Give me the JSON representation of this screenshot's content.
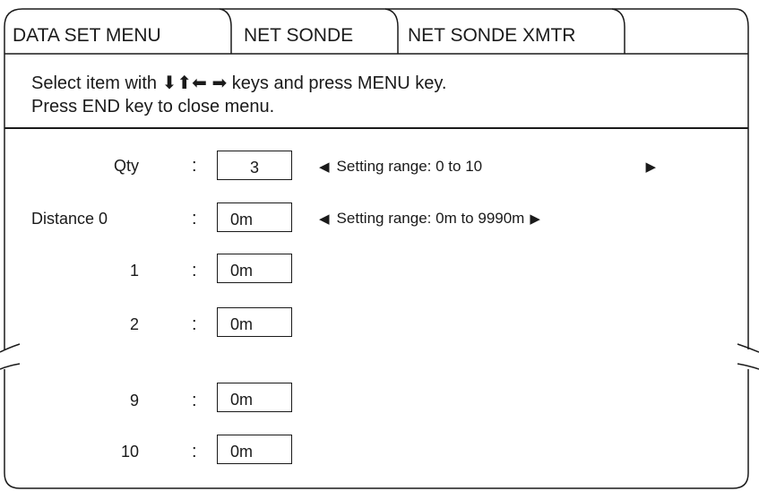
{
  "tabs": [
    "DATA SET MENU",
    "NET SONDE",
    "NET SONDE XMTR"
  ],
  "instructions": {
    "line1_prefix": "Select item with",
    "arrows": "⬇⬆⬅ ➡",
    "line1_suffix": "keys and press MENU key.",
    "line2": "Press END key to close menu."
  },
  "rows": [
    {
      "label": "Qty",
      "colon": ":",
      "value": "3"
    },
    {
      "label": "Distance 0",
      "colon": ":",
      "value": "0m"
    },
    {
      "label": "1",
      "colon": ":",
      "value": "0m"
    },
    {
      "label": "2",
      "colon": ":",
      "value": "0m"
    },
    {
      "label": "9",
      "colon": ":",
      "value": "0m"
    },
    {
      "label": "10",
      "colon": ":",
      "value": "0m"
    }
  ],
  "ranges": [
    {
      "left_arrow": "◀",
      "text": "Setting range: 0 to 10",
      "right_arrow": "▶"
    },
    {
      "left_arrow": "◀",
      "text": "Setting range: 0m to 9990m",
      "right_arrow": "▶"
    }
  ]
}
